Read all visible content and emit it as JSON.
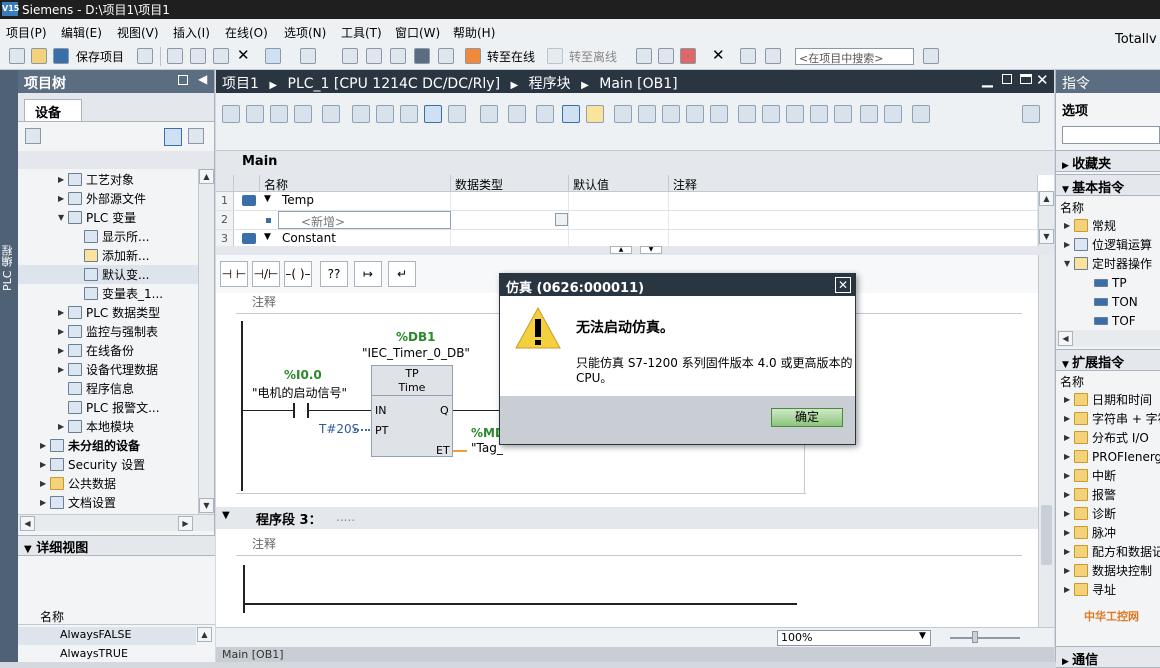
{
  "app": {
    "title": "Siemens  -  D:\\项目1\\项目1",
    "logo": "V15",
    "right_text": "Totally"
  },
  "menu": [
    "项目(P)",
    "编辑(E)",
    "视图(V)",
    "插入(I)",
    "在线(O)",
    "选项(N)",
    "工具(T)",
    "窗口(W)",
    "帮助(H)"
  ],
  "toolbar": {
    "save_label": "保存项目",
    "go_online": "转至在线",
    "go_offline": "转至离线",
    "search_placeholder": "<在项目中搜索>"
  },
  "left_strip": {
    "label": "PLC 编程"
  },
  "project_tree": {
    "title": "项目树",
    "tab": "设备",
    "items": [
      {
        "label": "工艺对象",
        "level": 2,
        "expand": "▶"
      },
      {
        "label": "外部源文件",
        "level": 2,
        "expand": "▶"
      },
      {
        "label": "PLC 变量",
        "level": 2,
        "expand": "▼"
      },
      {
        "label": "显示所...",
        "level": 3,
        "expand": ""
      },
      {
        "label": "添加新...",
        "level": 3,
        "expand": ""
      },
      {
        "label": "默认变...",
        "level": 3,
        "expand": ""
      },
      {
        "label": "变量表_1...",
        "level": 3,
        "expand": ""
      },
      {
        "label": "PLC 数据类型",
        "level": 2,
        "expand": "▶"
      },
      {
        "label": "监控与强制表",
        "level": 2,
        "expand": "▶"
      },
      {
        "label": "在线备份",
        "level": 2,
        "expand": "▶"
      },
      {
        "label": "设备代理数据",
        "level": 2,
        "expand": "▶"
      },
      {
        "label": "程序信息",
        "level": 2,
        "expand": ""
      },
      {
        "label": "PLC 报警文...",
        "level": 2,
        "expand": ""
      },
      {
        "label": "本地模块",
        "level": 2,
        "expand": "▶"
      },
      {
        "label": "未分组的设备",
        "level": 1,
        "expand": "▶"
      },
      {
        "label": "Security 设置",
        "level": 1,
        "expand": "▶"
      },
      {
        "label": "公共数据",
        "level": 1,
        "expand": "▶"
      },
      {
        "label": "文档设置",
        "level": 1,
        "expand": "▶"
      }
    ]
  },
  "detail_view": {
    "title": "详细视图",
    "col_name": "名称",
    "rows": [
      "AlwaysFALSE",
      "AlwaysTRUE"
    ]
  },
  "editor": {
    "breadcrumb": [
      "项目1",
      "PLC_1 [CPU 1214C DC/DC/Rly]",
      "程序块",
      "Main [OB1]"
    ],
    "block_name": "Main",
    "columns": [
      "名称",
      "数据类型",
      "默认值",
      "注释"
    ],
    "rows": [
      {
        "num": "1",
        "name": "Temp",
        "type": "",
        "default": "",
        "comment": ""
      },
      {
        "num": "2",
        "name": "<新增>",
        "type": "",
        "default": "",
        "comment": ""
      },
      {
        "num": "3",
        "name": "Constant",
        "type": "",
        "default": "",
        "comment": ""
      }
    ],
    "ladder_buttons": [
      "⊣ ⊢",
      "⊣/⊢",
      "–( )–",
      "??",
      "↦",
      "↵"
    ],
    "network2": {
      "comment": "注释",
      "db": "%DB1",
      "db_name": "\"IEC_Timer_0_DB\"",
      "block_type": "TP",
      "block_sub": "Time",
      "in_addr": "%I0.0",
      "in_name": "\"电机的启动信号\"",
      "pin_in": "IN",
      "pin_q": "Q",
      "pin_pt": "PT",
      "pin_et": "ET",
      "pt_val": "T#20S",
      "out_addr": "%MD",
      "out_name": "\"Tag_"
    },
    "network3": {
      "title": "程序段 3：",
      "dots": ".....",
      "comment": "注释"
    },
    "zoom": "100%",
    "bottom_tab": "Main [OB1]"
  },
  "right_panel": {
    "title": "指令",
    "options": "选项",
    "favorites": "收藏夹",
    "basic": "基本指令",
    "col_name": "名称",
    "basic_items": [
      {
        "label": "常规",
        "expand": "▶"
      },
      {
        "label": "位逻辑运算",
        "expand": "▶"
      },
      {
        "label": "定时器操作",
        "expand": "▼"
      },
      {
        "label": "TP",
        "expand": ""
      },
      {
        "label": "TON",
        "expand": ""
      },
      {
        "label": "TOF",
        "expand": ""
      }
    ],
    "extended": "扩展指令",
    "ext_items": [
      "日期和时间",
      "字符串 + 字符",
      "分布式 I/O",
      "PROFIenergy",
      "中断",
      "报警",
      "诊断",
      "脉冲",
      "配方和数据记录",
      "数据块控制",
      "寻址"
    ],
    "bottom": "通信",
    "watermark": "中华工控网"
  },
  "dialog": {
    "title": "仿真 (0626:000011)",
    "heading": "无法启动仿真。",
    "message_line1": "只能仿真 S7-1200 系列固件版本 4.0 或更高版本的",
    "message_line2": "CPU。",
    "ok": "确定",
    "close": "✕"
  }
}
